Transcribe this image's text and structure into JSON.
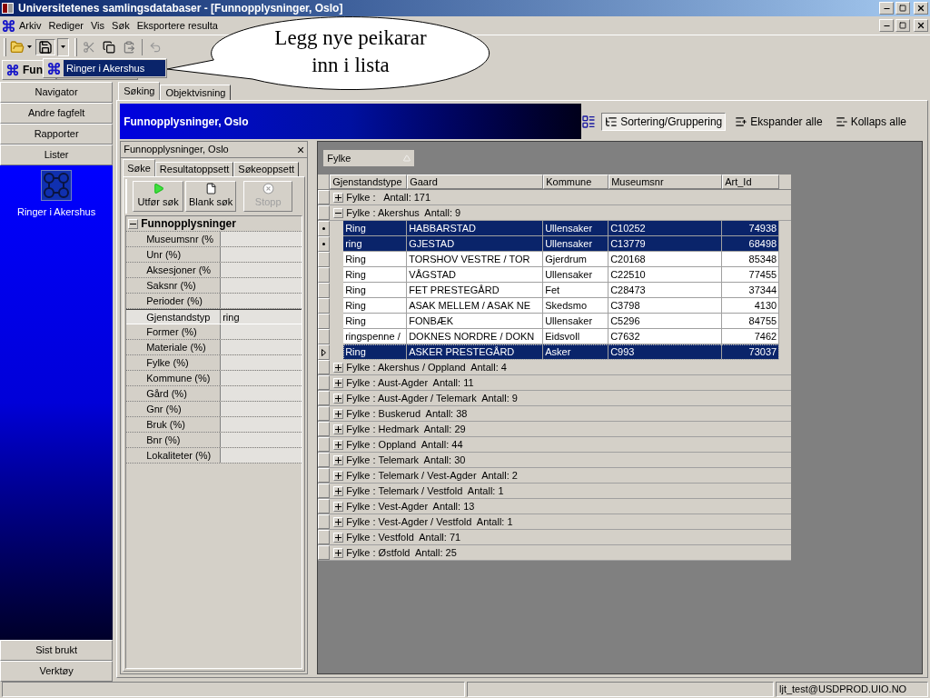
{
  "window": {
    "title": "Universitetenes samlingsdatabaser - [Funnopplysninger, Oslo]"
  },
  "menu": [
    "Arkiv",
    "Rediger",
    "Vis",
    "Søk",
    "Eksportere resulta"
  ],
  "doc_tabs": [
    {
      "label": "Fun",
      "selected": true
    },
    {
      "selected": false
    }
  ],
  "dropdown": {
    "item": "Ringer i Akershus"
  },
  "callout": {
    "lines": [
      "Legg nye peikarar",
      "inn i lista"
    ]
  },
  "navigator": {
    "top": [
      "Navigator",
      "Andre fagfelt",
      "Rapporter",
      "Lister"
    ],
    "list_item": "Ringer i Akershus",
    "bottom": [
      "Sist brukt",
      "Verktøy"
    ]
  },
  "view_tabs": [
    {
      "label": "Søking",
      "selected": true
    },
    {
      "label": "Objektvisning",
      "selected": false
    }
  ],
  "header": {
    "title": "Funnopplysninger, Oslo",
    "tools": [
      {
        "label": "Sortering/Gruppering",
        "selected": true
      },
      {
        "label": "Ekspander alle",
        "selected": false
      },
      {
        "label": "Kollaps alle",
        "selected": false
      }
    ]
  },
  "search_panel": {
    "title": "Funnopplysninger, Oslo",
    "close": "×",
    "tabs": [
      {
        "label": "Søke",
        "selected": true
      },
      {
        "label": "Resultatoppsett",
        "selected": false
      },
      {
        "label": "Søkeoppsett",
        "selected": false
      }
    ],
    "buttons": [
      {
        "label": "Utfør søk",
        "disabled": false
      },
      {
        "label": "Blank søk",
        "disabled": false
      },
      {
        "label": "Stopp",
        "disabled": true
      }
    ],
    "group": "Funnopplysninger",
    "expanded": true,
    "fields": [
      {
        "label": "Museumsnr (%",
        "selected": false
      },
      {
        "label": "Unr (%)",
        "selected": false
      },
      {
        "label": "Aksesjoner (%",
        "selected": false
      },
      {
        "label": "Saksnr (%)",
        "selected": false
      },
      {
        "label": "Perioder (%)",
        "selected": false
      },
      {
        "label": "Gjenstandstyp",
        "value": "ring",
        "selected": true
      },
      {
        "label": "Former (%)",
        "selected": false
      },
      {
        "label": "Materiale (%)",
        "selected": false
      },
      {
        "label": "Fylke (%)",
        "selected": false
      },
      {
        "label": "Kommune (%)",
        "selected": false
      },
      {
        "label": "Gård (%)",
        "selected": false
      },
      {
        "label": "Gnr (%)",
        "selected": false
      },
      {
        "label": "Bruk (%)",
        "selected": false
      },
      {
        "label": "Bnr (%)",
        "selected": false
      },
      {
        "label": "Lokaliteter (%)",
        "selected": false
      }
    ]
  },
  "grid": {
    "group_by": "Fylke",
    "columns": [
      "Gjenstandstype",
      "Gaard",
      "Kommune",
      "Museumsnr",
      "Art_Id"
    ],
    "rows": [
      {
        "kind": "group",
        "text": "Fylke :   Antall: 171",
        "expanded": false
      },
      {
        "kind": "group",
        "text": "Fylke : Akershus  Antall: 9",
        "expanded": true
      },
      {
        "kind": "item",
        "cells": [
          "Ring",
          "HABBARSTAD",
          "Ullensaker",
          "C10252",
          "74938"
        ],
        "selected": true,
        "current": false
      },
      {
        "kind": "item",
        "cells": [
          "ring",
          "GJESTAD",
          "Ullensaker",
          "C13779",
          "68498"
        ],
        "selected": true,
        "current": false
      },
      {
        "kind": "item",
        "cells": [
          "Ring",
          "TORSHOV VESTRE / TOR",
          "Gjerdrum",
          "C20168",
          "85348"
        ],
        "selected": false,
        "current": false
      },
      {
        "kind": "item",
        "cells": [
          "Ring",
          "VÅGSTAD",
          "Ullensaker",
          "C22510",
          "77455"
        ],
        "selected": false,
        "current": false
      },
      {
        "kind": "item",
        "cells": [
          "Ring",
          "FET PRESTEGÅRD",
          "Fet",
          "C28473",
          "37344"
        ],
        "selected": false,
        "current": false
      },
      {
        "kind": "item",
        "cells": [
          "Ring",
          "ASAK MELLEM / ASAK NE",
          "Skedsmo",
          "C3798",
          "4130"
        ],
        "selected": false,
        "current": false
      },
      {
        "kind": "item",
        "cells": [
          "Ring",
          "FONBÆK",
          "Ullensaker",
          "C5296",
          "84755"
        ],
        "selected": false,
        "current": false
      },
      {
        "kind": "item",
        "cells": [
          "ringspenne /",
          "DOKNES NORDRE / DOKN",
          "Eidsvoll",
          "C7632",
          "7462"
        ],
        "selected": false,
        "current": false
      },
      {
        "kind": "item",
        "cells": [
          "Ring",
          "ASKER PRESTEGÅRD",
          "Asker",
          "C993",
          "73037"
        ],
        "selected": true,
        "current": true
      },
      {
        "kind": "group",
        "text": "Fylke : Akershus / Oppland  Antall: 4",
        "expanded": false
      },
      {
        "kind": "group",
        "text": "Fylke : Aust-Agder  Antall: 11",
        "expanded": false
      },
      {
        "kind": "group",
        "text": "Fylke : Aust-Agder / Telemark  Antall: 9",
        "expanded": false
      },
      {
        "kind": "group",
        "text": "Fylke : Buskerud  Antall: 38",
        "expanded": false
      },
      {
        "kind": "group",
        "text": "Fylke : Hedmark  Antall: 29",
        "expanded": false
      },
      {
        "kind": "group",
        "text": "Fylke : Oppland  Antall: 44",
        "expanded": false
      },
      {
        "kind": "group",
        "text": "Fylke : Telemark  Antall: 30",
        "expanded": false
      },
      {
        "kind": "group",
        "text": "Fylke : Telemark / Vest-Agder  Antall: 2",
        "expanded": false
      },
      {
        "kind": "group",
        "text": "Fylke : Telemark / Vestfold  Antall: 1",
        "expanded": false
      },
      {
        "kind": "group",
        "text": "Fylke : Vest-Agder  Antall: 13",
        "expanded": false
      },
      {
        "kind": "group",
        "text": "Fylke : Vest-Agder / Vestfold  Antall: 1",
        "expanded": false
      },
      {
        "kind": "group",
        "text": "Fylke : Vestfold  Antall: 71",
        "expanded": false
      },
      {
        "kind": "group",
        "text": "Fylke : Østfold  Antall: 25",
        "expanded": false
      }
    ]
  },
  "status_bar": {
    "user": "ljt_test@USDPROD.UIO.NO"
  }
}
